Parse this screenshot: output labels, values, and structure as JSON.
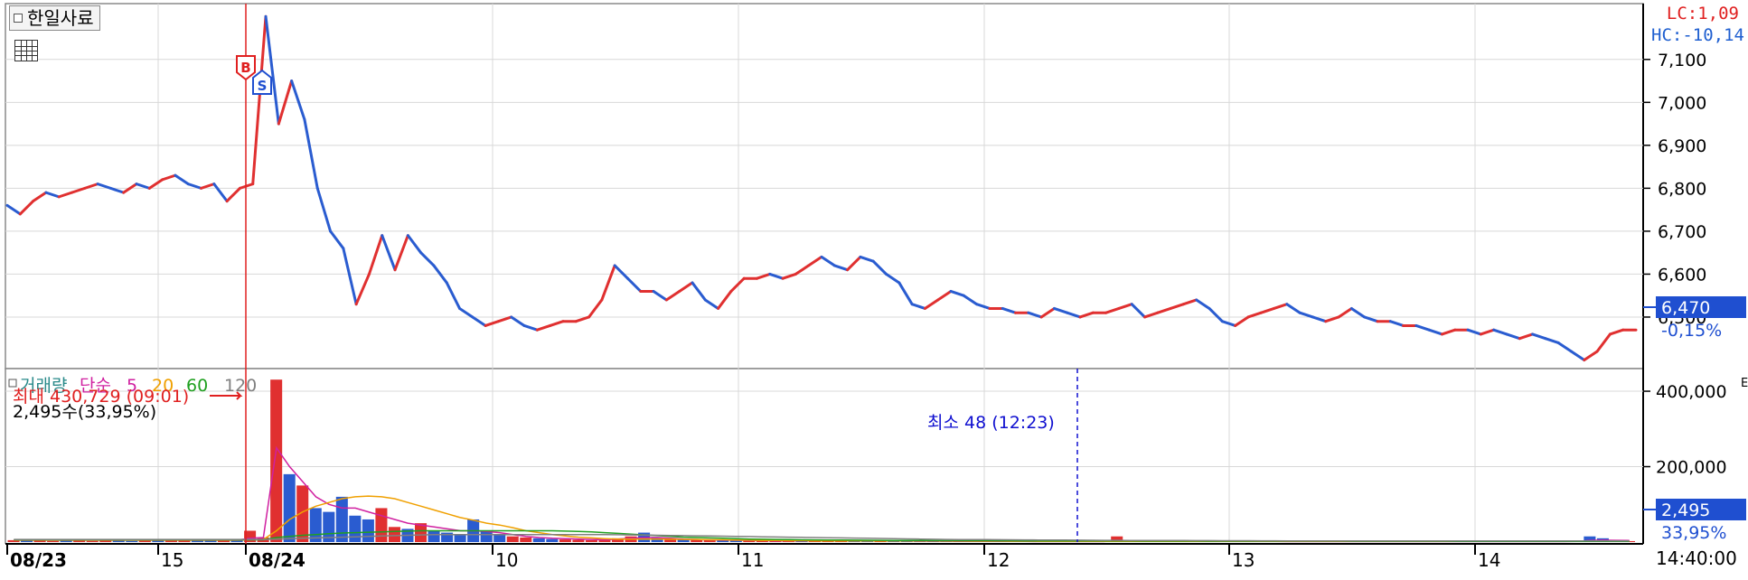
{
  "stock_name": "한일사료",
  "lc_label": "LC:1,09",
  "hc_label": "HC:-10,14",
  "price_now": "6,470",
  "price_pct": "-0,15%",
  "vol_now": "2,495",
  "vol_pct": "33,95%",
  "legend": {
    "volume": "거래량",
    "simple": "단순",
    "p5": "5",
    "p20": "20",
    "p60": "60",
    "p120": "120"
  },
  "vol_max_label": "최대 430,729 (09:01)",
  "vol_max_sub": "2,495수(33,95%)",
  "vol_min_label": "최소 48 (12:23)",
  "buy_marker": "B",
  "sell_marker": "S",
  "time_label": "14:40:00",
  "edge_mark": "E",
  "colors": {
    "up": "#e03030",
    "down": "#2a5cd0",
    "grid": "#d8d8d8",
    "axis": "#000000"
  },
  "chart_data": [
    {
      "type": "line",
      "title": "한일사료",
      "x_ticks": [
        "08/23",
        "15",
        "08/24",
        "10",
        "11",
        "12",
        "13",
        "14"
      ],
      "y_ticks": [
        6500,
        6600,
        6700,
        6800,
        6900,
        7000,
        7100
      ],
      "y_tick_labels": [
        "6,500",
        "6,600",
        "6,700",
        "6,800",
        "6,900",
        "7,000",
        "7,100"
      ],
      "ylim": [
        6380,
        7230
      ],
      "series": [
        {
          "values": [
            6760,
            6740,
            6770,
            6790,
            6780,
            6790,
            6800,
            6810,
            6800,
            6790,
            6810,
            6800,
            6820,
            6830,
            6810,
            6800,
            6810,
            6770,
            6800,
            6810,
            7200,
            6950,
            7050,
            6960,
            6800,
            6700,
            6660,
            6530,
            6600,
            6690,
            6610,
            6690,
            6650,
            6620,
            6580,
            6520,
            6500,
            6480,
            6490,
            6500,
            6480,
            6470,
            6480,
            6490,
            6490,
            6500,
            6540,
            6620,
            6590,
            6560,
            6560,
            6540,
            6560,
            6580,
            6540,
            6520,
            6560,
            6590,
            6590,
            6600,
            6590,
            6600,
            6620,
            6640,
            6620,
            6610,
            6640,
            6630,
            6600,
            6580,
            6530,
            6520,
            6540,
            6560,
            6550,
            6530,
            6520,
            6520,
            6510,
            6510,
            6500,
            6520,
            6510,
            6500,
            6510,
            6510,
            6520,
            6530,
            6500,
            6510,
            6520,
            6530,
            6540,
            6520,
            6490,
            6480,
            6500,
            6510,
            6520,
            6530,
            6510,
            6500,
            6490,
            6500,
            6520,
            6500,
            6490,
            6490,
            6480,
            6480,
            6470,
            6460,
            6470,
            6470,
            6460,
            6470,
            6460,
            6450,
            6460,
            6450,
            6440,
            6420,
            6400,
            6420,
            6460,
            6470,
            6470
          ]
        }
      ]
    },
    {
      "type": "bar",
      "title": "거래량",
      "y_ticks": [
        200000,
        400000
      ],
      "y_tick_labels": [
        "200,000",
        "400,000"
      ],
      "ylim": [
        0,
        460000
      ],
      "series": [
        {
          "name": "거래량",
          "values": [
            5000,
            4000,
            6000,
            3000,
            5000,
            4000,
            3000,
            6000,
            4000,
            3000,
            5000,
            4000,
            8000,
            6000,
            5000,
            4000,
            6000,
            5000,
            30000,
            12000,
            430729,
            180000,
            150000,
            90000,
            80000,
            120000,
            70000,
            60000,
            90000,
            40000,
            35000,
            50000,
            30000,
            25000,
            20000,
            60000,
            30000,
            20000,
            15000,
            12000,
            10000,
            8000,
            7000,
            6000,
            5000,
            5000,
            10000,
            15000,
            25000,
            12000,
            9000,
            7000,
            6000,
            5000,
            5000,
            4000,
            4000,
            3000,
            3000,
            3000,
            3000,
            3000,
            3000,
            4000,
            3000,
            3000,
            3000,
            3000,
            2500,
            2500,
            2000,
            2000,
            2000,
            2000,
            2000,
            2000,
            2000,
            1500,
            1500,
            1500,
            1500,
            1500,
            1500,
            1500,
            15000,
            2000,
            2000,
            2000,
            2000,
            2000,
            2000,
            2000,
            2000,
            2000,
            2000,
            2000,
            2000,
            1500,
            1500,
            1500,
            1500,
            1500,
            1500,
            1500,
            1500,
            1500,
            1500,
            1500,
            1500,
            1500,
            1500,
            1500,
            1500,
            1500,
            1500,
            1500,
            1500,
            2000,
            2000,
            2000,
            15000,
            10000,
            3000,
            2495
          ]
        },
        {
          "name": "5",
          "values": [
            5000,
            5000,
            5000,
            5000,
            5000,
            5000,
            5000,
            5000,
            5000,
            5000,
            5000,
            5000,
            5000,
            5000,
            5000,
            5000,
            5000,
            5000,
            10000,
            12000,
            250000,
            200000,
            160000,
            120000,
            100000,
            90000,
            90000,
            80000,
            70000,
            60000,
            50000,
            45000,
            40000,
            35000,
            30000,
            30000,
            28000,
            25000,
            20000,
            15000,
            12000,
            10000,
            9000,
            8000,
            7000,
            6000,
            8000,
            10000,
            12000,
            12000,
            10000,
            8000,
            7000,
            6000,
            5000,
            5000,
            4000,
            4000,
            3000,
            3000,
            3000,
            3000,
            3000,
            3000,
            3000,
            3000,
            3000,
            3000,
            3000,
            2500,
            2500,
            2500,
            2000,
            2000,
            2000,
            2000,
            2000,
            2000,
            1500,
            1500,
            1500,
            1500,
            1500,
            1500,
            4000,
            3000,
            2500,
            2000,
            2000,
            2000,
            2000,
            2000,
            2000,
            2000,
            2000,
            2000,
            2000,
            1500,
            1500,
            1500,
            1500,
            1500,
            1500,
            1500,
            1500,
            1500,
            1500,
            1500,
            1500,
            1500,
            1500,
            1500,
            1500,
            1500,
            1500,
            1500,
            1500,
            1500,
            1500,
            2000,
            4000,
            5000,
            4500,
            4000
          ]
        },
        {
          "name": "20",
          "values": [
            5000,
            5000,
            5000,
            5000,
            5000,
            5000,
            5000,
            5000,
            5000,
            5000,
            5000,
            5000,
            5000,
            5000,
            5000,
            5000,
            5000,
            5000,
            6000,
            7000,
            30000,
            60000,
            80000,
            95000,
            105000,
            115000,
            120000,
            122000,
            120000,
            115000,
            105000,
            95000,
            85000,
            75000,
            65000,
            58000,
            50000,
            45000,
            38000,
            30000,
            25000,
            20000,
            16000,
            13000,
            11000,
            9000,
            8000,
            8000,
            8000,
            8000,
            8000,
            7000,
            7000,
            6000,
            6000,
            5000,
            5000,
            4000,
            4000,
            3500,
            3500,
            3200,
            3000,
            3000,
            3000,
            3000,
            3000,
            3000,
            3000,
            3000,
            2800,
            2700,
            2600,
            2500,
            2400,
            2300,
            2200,
            2100,
            2000,
            2000,
            2000,
            1800,
            1800,
            1800,
            2000,
            2000,
            2000,
            2000,
            2000,
            2000,
            2000,
            2000,
            2000,
            2000,
            2000,
            2000,
            2000,
            2000,
            1800,
            1700,
            1700,
            1600,
            1600,
            1600,
            1600,
            1600,
            1600,
            1600,
            1600,
            1600,
            1600,
            1600,
            1600,
            1600,
            1600,
            1600,
            1600,
            1600,
            1600,
            1600,
            2000,
            2500,
            3000,
            3000
          ]
        },
        {
          "name": "60",
          "values": [
            6000,
            6000,
            6000,
            6000,
            6000,
            6000,
            6000,
            6000,
            6000,
            6000,
            6000,
            6000,
            6000,
            6000,
            6000,
            6000,
            6000,
            6000,
            6000,
            6000,
            12000,
            15000,
            18000,
            20000,
            22000,
            24000,
            25000,
            26000,
            27000,
            28000,
            29000,
            30000,
            30000,
            30000,
            30000,
            30000,
            30000,
            30000,
            30000,
            30000,
            30000,
            30000,
            29000,
            28000,
            27000,
            25000,
            23000,
            21000,
            19000,
            17000,
            15000,
            13000,
            12000,
            11000,
            10000,
            9000,
            8000,
            7500,
            7000,
            6500,
            6000,
            5800,
            5500,
            5300,
            5000,
            4800,
            4600,
            4400,
            4200,
            4000,
            3900,
            3800,
            3700,
            3600,
            3500,
            3400,
            3300,
            3200,
            3100,
            3000,
            3000,
            2900,
            2900,
            2800,
            2800,
            2800,
            2700,
            2700,
            2600,
            2600,
            2600,
            2500,
            2500,
            2500,
            2500,
            2400,
            2400,
            2400,
            2300,
            2300,
            2300,
            2300,
            2200,
            2200,
            2200,
            2200,
            2100,
            2100,
            2100,
            2100,
            2000,
            2000,
            2000,
            2000,
            2000,
            2000,
            2000,
            2000,
            2000,
            2000,
            2000,
            2000,
            2000,
            2000
          ]
        },
        {
          "name": "120",
          "values": [
            7000,
            7000,
            7000,
            7000,
            7000,
            7000,
            7000,
            7000,
            7000,
            7000,
            7000,
            7000,
            7000,
            7000,
            7000,
            7000,
            7000,
            7000,
            7000,
            7000,
            8000,
            9000,
            10000,
            11000,
            12000,
            13000,
            14000,
            15000,
            16000,
            17000,
            18000,
            19000,
            20000,
            20000,
            20000,
            20000,
            20000,
            20000,
            20000,
            20000,
            20000,
            20000,
            20000,
            20000,
            20000,
            20000,
            19500,
            19000,
            18500,
            18000,
            17500,
            17000,
            16500,
            16000,
            15500,
            15000,
            14500,
            14000,
            13500,
            13000,
            12500,
            12000,
            11500,
            11000,
            10500,
            10000,
            9500,
            9000,
            8500,
            8000,
            7500,
            7000,
            6800,
            6600,
            6400,
            6200,
            6000,
            5800,
            5600,
            5400,
            5200,
            5000,
            4800,
            4600,
            4500,
            4400,
            4300,
            4200,
            4100,
            4000,
            3900,
            3800,
            3700,
            3600,
            3500,
            3400,
            3300,
            3200,
            3100,
            3000,
            3000,
            3000,
            3000,
            3000,
            3000,
            3000,
            3000,
            3000,
            3000,
            3000,
            3000,
            3000,
            3000,
            3000,
            3000,
            3000,
            3000,
            3000,
            3000,
            3000,
            3000,
            3000,
            3000,
            3000
          ]
        }
      ]
    }
  ]
}
